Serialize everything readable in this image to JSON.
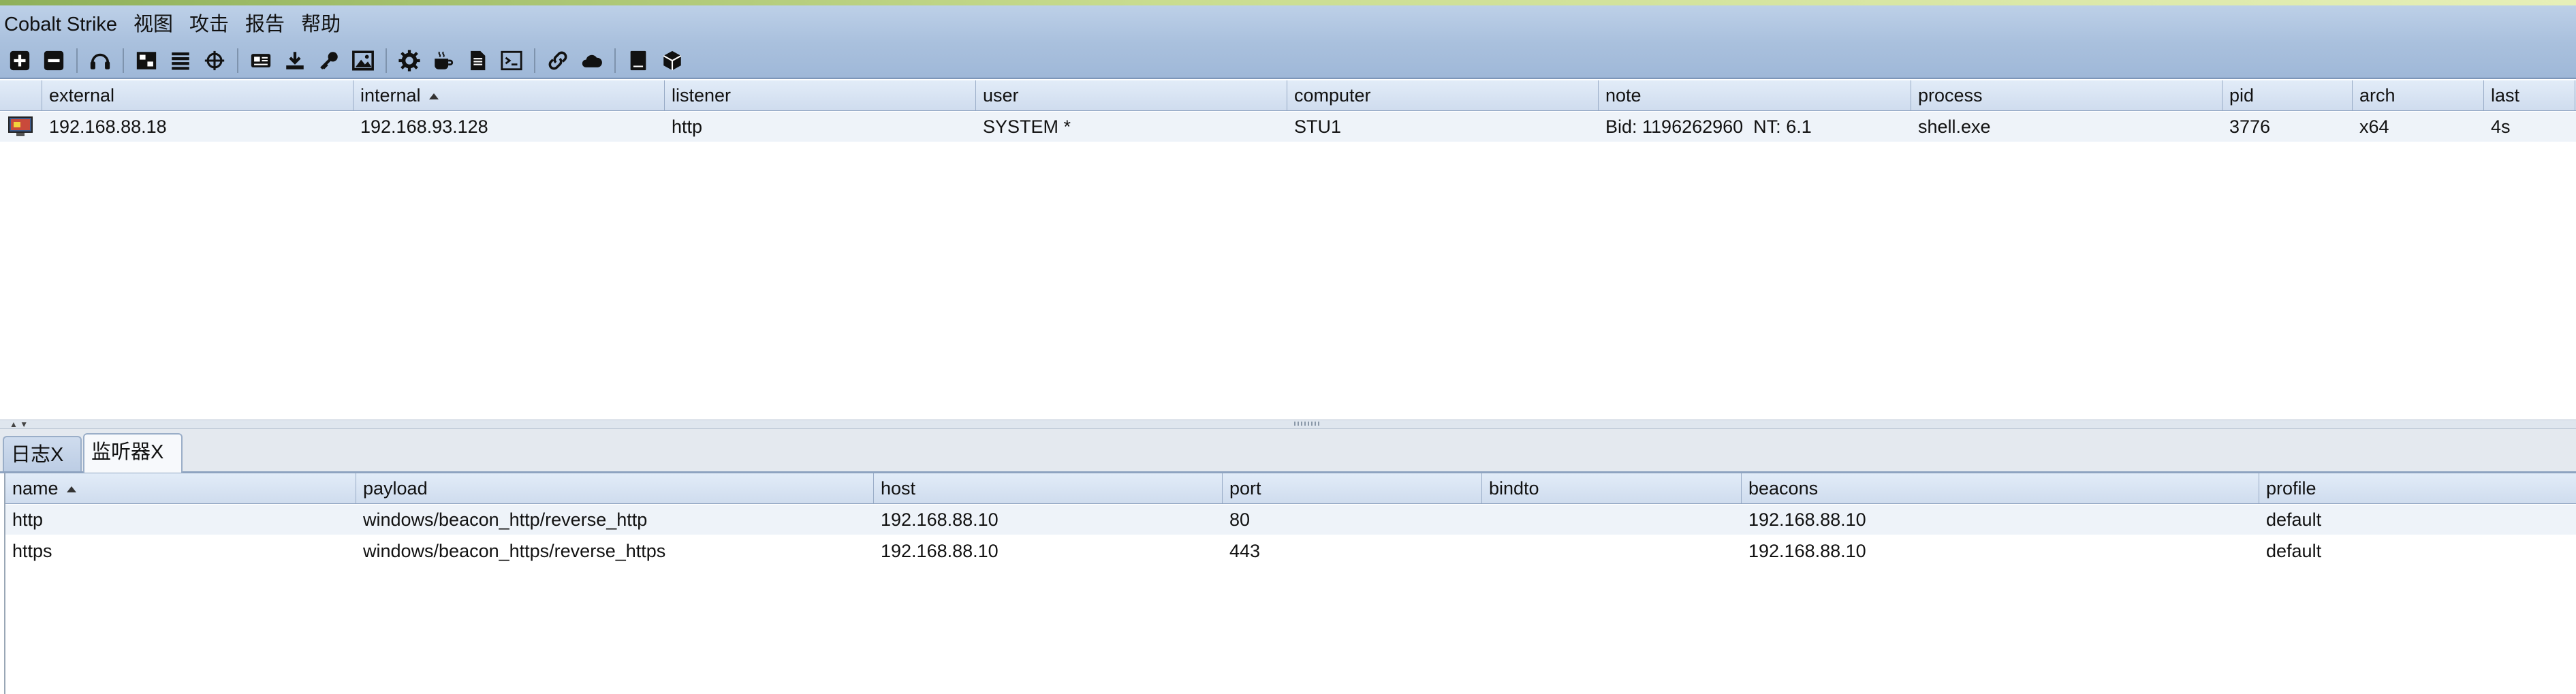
{
  "menu": [
    "Cobalt Strike",
    "视图",
    "攻击",
    "报告",
    "帮助"
  ],
  "toolbar": {
    "icons": [
      "new-connection-icon",
      "disconnect-icon",
      "listeners-icon",
      "pivot-graph-icon",
      "session-table-icon",
      "targets-icon",
      "credentials-icon",
      "downloads-icon",
      "keystrokes-icon",
      "screenshots-icon",
      "payload-generator-icon",
      "java-applet-icon",
      "office-macro-icon",
      "script-console-icon",
      "manage-sites-icon",
      "cloud-icon",
      "log-icon",
      "package-icon"
    ]
  },
  "sessions": {
    "columns": [
      "",
      "external",
      "internal",
      "listener",
      "user",
      "computer",
      "note",
      "process",
      "pid",
      "arch",
      "last"
    ],
    "sorted_column": "internal",
    "rows": [
      {
        "external": "192.168.88.18",
        "internal": "192.168.93.128",
        "listener": "http",
        "user": "SYSTEM *",
        "computer": "STU1",
        "note": "Bid: 1196262960  NT: 6.1",
        "process": "shell.exe",
        "pid": "3776",
        "arch": "x64",
        "last": "4s"
      }
    ]
  },
  "tabs": [
    {
      "label": "日志X",
      "active": false
    },
    {
      "label": "监听器X",
      "active": true
    }
  ],
  "listeners": {
    "columns": [
      "name",
      "payload",
      "host",
      "port",
      "bindto",
      "beacons",
      "profile"
    ],
    "sorted_column": "name",
    "rows": [
      {
        "name": "http",
        "payload": "windows/beacon_http/reverse_http",
        "host": "192.168.88.10",
        "port": "80",
        "bindto": "",
        "beacons": "192.168.88.10",
        "profile": "default"
      },
      {
        "name": "https",
        "payload": "windows/beacon_https/reverse_https",
        "host": "192.168.88.10",
        "port": "443",
        "bindto": "",
        "beacons": "192.168.88.10",
        "profile": "default"
      }
    ]
  }
}
